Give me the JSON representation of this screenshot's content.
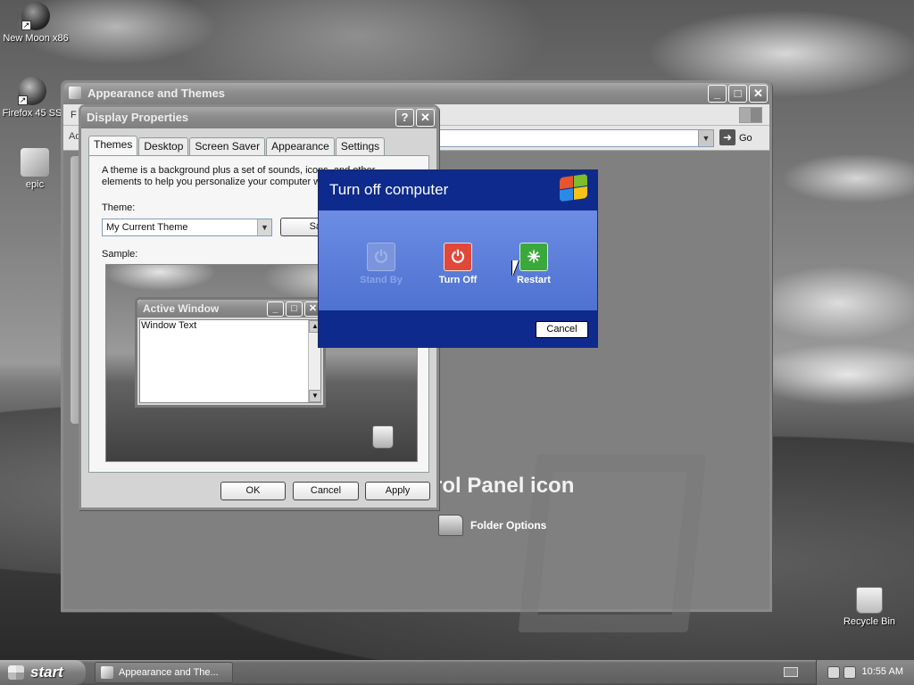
{
  "desktop": {
    "icons": [
      {
        "label": "New Moon x86",
        "icon": "new-moon-browser-icon"
      },
      {
        "label": "Firefox 45 SS",
        "icon": "firefox-icon"
      },
      {
        "label": "epic",
        "icon": "epic-icon"
      },
      {
        "label": "Recycle Bin",
        "icon": "recycle-bin-icon"
      }
    ]
  },
  "control_window": {
    "title": "Appearance and Themes",
    "menu_initial": "F",
    "address_label": "Ad",
    "go_label": "Go",
    "heading": "rol Panel icon",
    "task_label": "Folder Options"
  },
  "display_properties": {
    "title": "Display Properties",
    "tabs": [
      "Themes",
      "Desktop",
      "Screen Saver",
      "Appearance",
      "Settings"
    ],
    "active_tab": "Themes",
    "description": "A theme is a background plus a set of sounds, icons, and other elements to help you personalize your computer with one click.",
    "theme_label": "Theme:",
    "theme_value": "My Current Theme",
    "save_label": "Save A",
    "sample_label": "Sample:",
    "sample_window_title": "Active Window",
    "sample_window_text": "Window Text",
    "buttons": {
      "ok": "OK",
      "cancel": "Cancel",
      "apply": "Apply"
    }
  },
  "turn_off_dialog": {
    "title": "Turn off computer",
    "options": [
      {
        "label": "Stand By",
        "state": "disabled"
      },
      {
        "label": "Turn Off",
        "state": "enabled"
      },
      {
        "label": "Restart",
        "state": "enabled"
      }
    ],
    "cancel_label": "Cancel"
  },
  "taskbar": {
    "start_label": "start",
    "task_button": "Appearance and The...",
    "clock": "10:55 AM"
  },
  "colors": {
    "dialog_blue": "#0e2a8c",
    "dialog_mid": "#5d7fda",
    "turn_off_red": "#e0483a",
    "restart_green": "#3aa83a"
  }
}
